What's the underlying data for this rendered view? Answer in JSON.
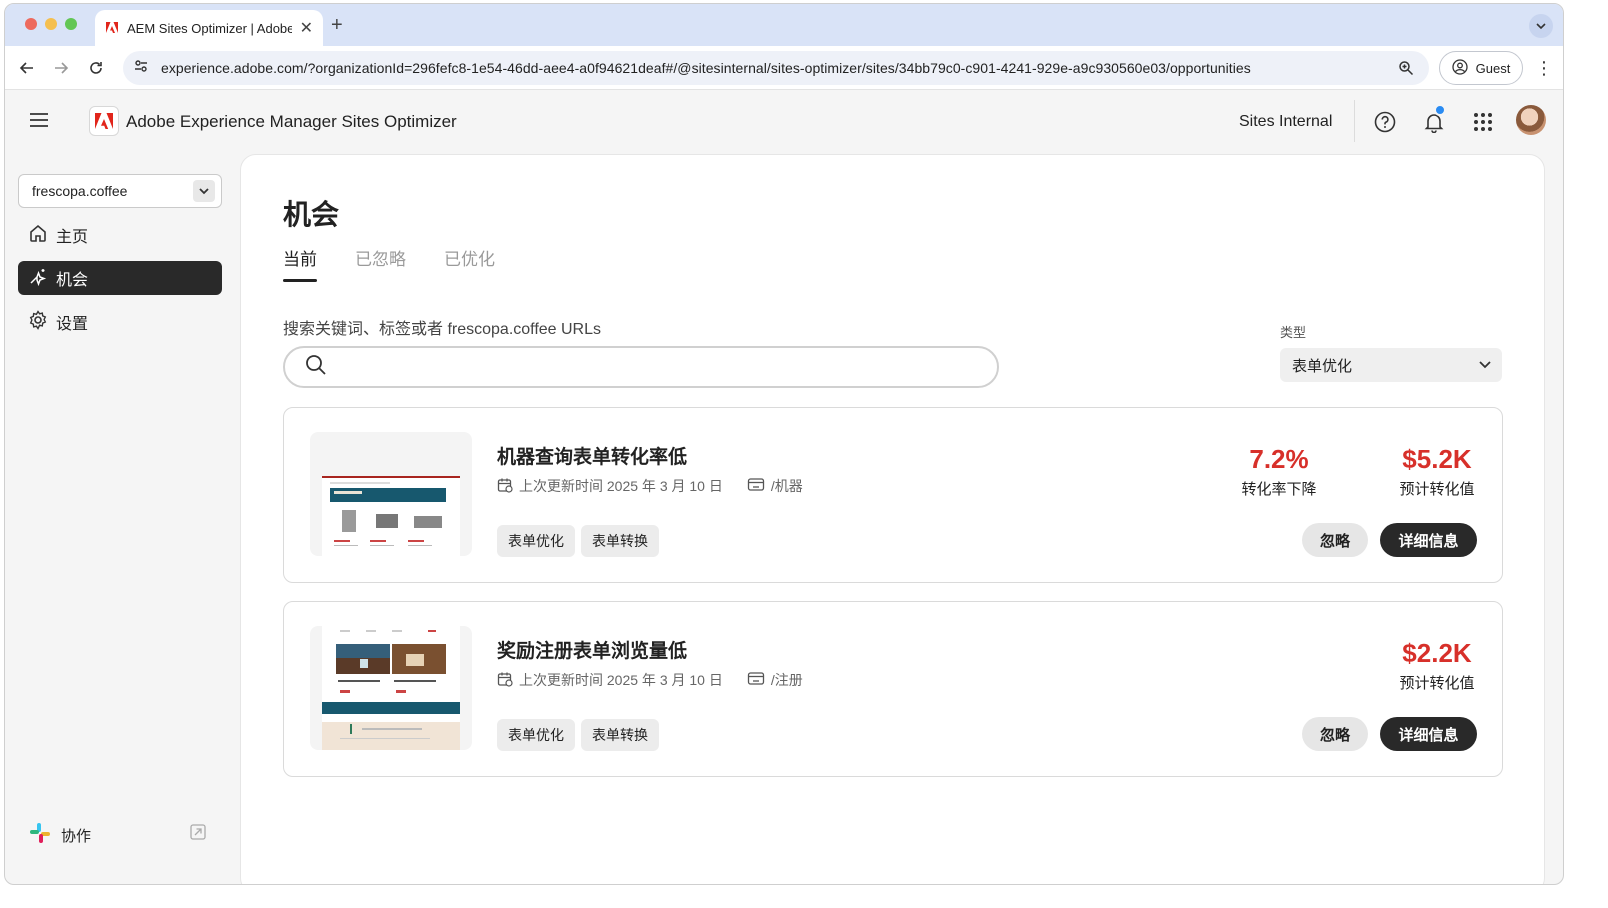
{
  "browser": {
    "tab_title": "AEM Sites Optimizer | Adobe",
    "url": "experience.adobe.com/?organizationId=296fefc8-1e54-46dd-aee4-a0f94621deaf#/@sitesinternal/sites-optimizer/sites/34bb79c0-c901-4241-929e-a9c930560e03/opportunities",
    "profile_label": "Guest"
  },
  "header": {
    "app_title": "Adobe Experience Manager Sites Optimizer",
    "org_name": "Sites Internal",
    "notification_dot_color": "#2a8bf2"
  },
  "sidebar": {
    "site_selector_value": "frescopa.coffee",
    "items": [
      {
        "label": "主页",
        "icon": "home-icon"
      },
      {
        "label": "机会",
        "icon": "opportunity-icon",
        "active": true
      },
      {
        "label": "设置",
        "icon": "gear-icon"
      }
    ],
    "collab_label": "协作"
  },
  "main": {
    "title": "机会",
    "tabs": [
      {
        "label": "当前",
        "active": true
      },
      {
        "label": "已忽略"
      },
      {
        "label": "已优化"
      }
    ],
    "search_label": "搜索关键词、标签或者 frescopa.coffee URLs",
    "search_value": "",
    "type_label": "类型",
    "type_value": "表单优化"
  },
  "cards": [
    {
      "title": "机器查询表单转化率低",
      "updated": "上次更新时间 2025 年 3 月 10 日",
      "path": "/机器",
      "tags": [
        "表单优化",
        "表单转换"
      ],
      "metric1_value": "7.2%",
      "metric1_label": "转化率下降",
      "metric2_value": "$5.2K",
      "metric2_label": "预计转化值",
      "ignore_label": "忽略",
      "detail_label": "详细信息"
    },
    {
      "title": "奖励注册表单浏览量低",
      "updated": "上次更新时间 2025 年 3 月 10 日",
      "path": "/注册",
      "tags": [
        "表单优化",
        "表单转换"
      ],
      "metric2_value": "$2.2K",
      "metric2_label": "预计转化值",
      "ignore_label": "忽略",
      "detail_label": "详细信息"
    }
  ],
  "colors": {
    "accent_red": "#d7302a",
    "active_nav_bg": "#292929"
  }
}
